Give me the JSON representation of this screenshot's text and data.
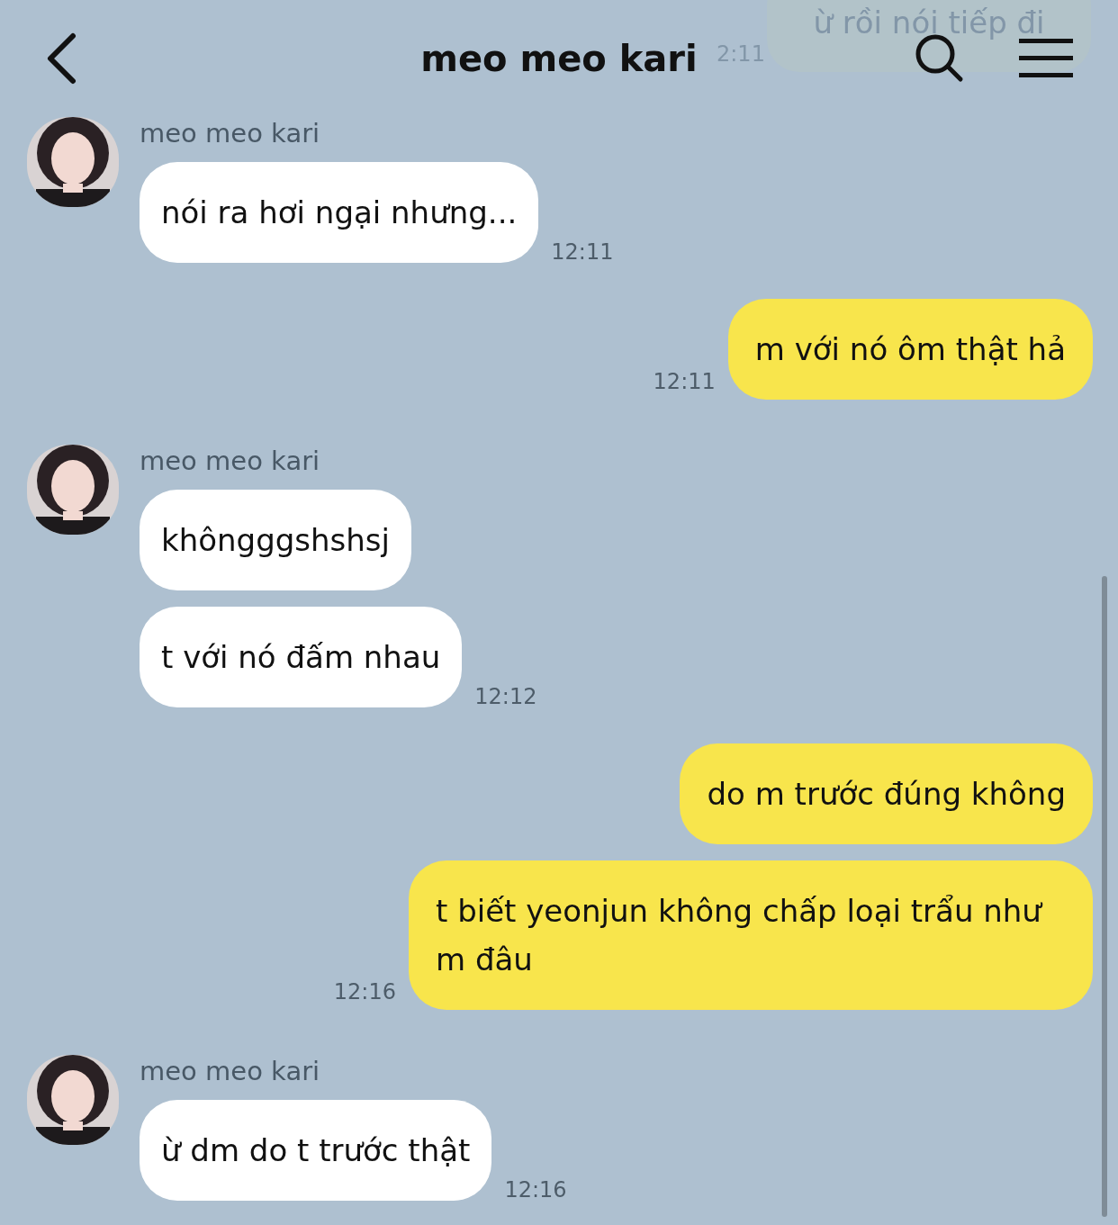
{
  "header": {
    "title": "meo meo kari"
  },
  "scrolled_under": {
    "text": "ừ rồi nói tiếp đi",
    "time": "2:11"
  },
  "messages": [
    {
      "kind": "received",
      "sender": "meo meo kari",
      "text": "nói ra hơi ngại nhưng...",
      "time": "12:11"
    },
    {
      "kind": "sent",
      "text": "m với nó ôm thật hả",
      "time": "12:11"
    },
    {
      "kind": "received",
      "sender": "meo meo kari",
      "text": "khôngggshshsj"
    },
    {
      "kind": "received",
      "text": "t với nó đấm nhau",
      "time": "12:12"
    },
    {
      "kind": "sent",
      "text": "do m trước đúng không"
    },
    {
      "kind": "sent",
      "text": "t biết yeonjun không chấp loại trẩu như m đâu",
      "time": "12:16"
    },
    {
      "kind": "received",
      "sender": "meo meo kari",
      "text": "ừ dm do t trước thật",
      "time": "12:16"
    }
  ]
}
